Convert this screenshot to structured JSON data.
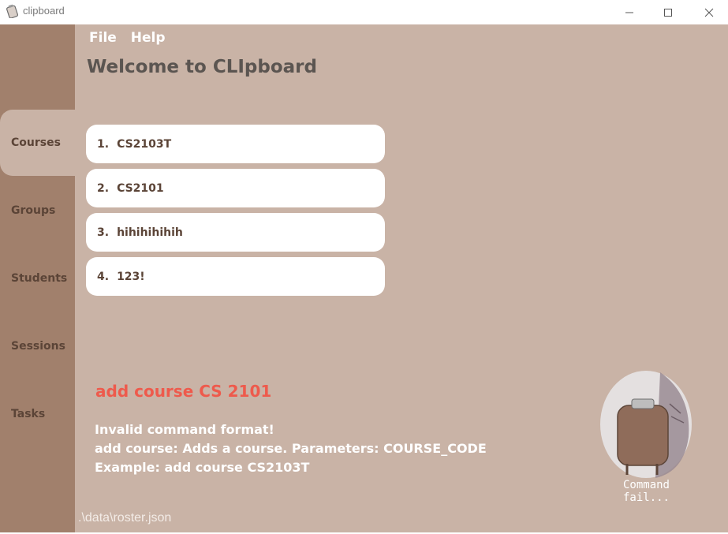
{
  "window": {
    "title": "clipboard",
    "icon": "clipboard-icon"
  },
  "menu": {
    "file": "File",
    "help": "Help"
  },
  "header": {
    "welcome": "Welcome to CLIpboard"
  },
  "sidebar": {
    "items": [
      {
        "label": "Courses",
        "active": true
      },
      {
        "label": "Groups",
        "active": false
      },
      {
        "label": "Students",
        "active": false
      },
      {
        "label": "Sessions",
        "active": false
      },
      {
        "label": "Tasks",
        "active": false
      }
    ]
  },
  "courses": [
    {
      "index": "1.",
      "code": "CS2103T"
    },
    {
      "index": "2.",
      "code": "CS2101"
    },
    {
      "index": "3.",
      "code": "hihihihihih"
    },
    {
      "index": "4.",
      "code": "123!"
    }
  ],
  "command": {
    "echo": "add course CS 2101",
    "result_lines": [
      "Invalid command format!",
      "add course: Adds a course. Parameters: COURSE_CODE",
      "Example: add course CS2103T"
    ]
  },
  "mascot": {
    "icon": "clipboard-mascot-icon",
    "caption": "Command fail..."
  },
  "status": {
    "path": ".\\data\\roster.json"
  },
  "colors": {
    "sidebar": "#a1806c",
    "main": "#c9b3a6",
    "card": "#ffffff",
    "error": "#ee5a4c",
    "text_dark": "#5b4437"
  }
}
